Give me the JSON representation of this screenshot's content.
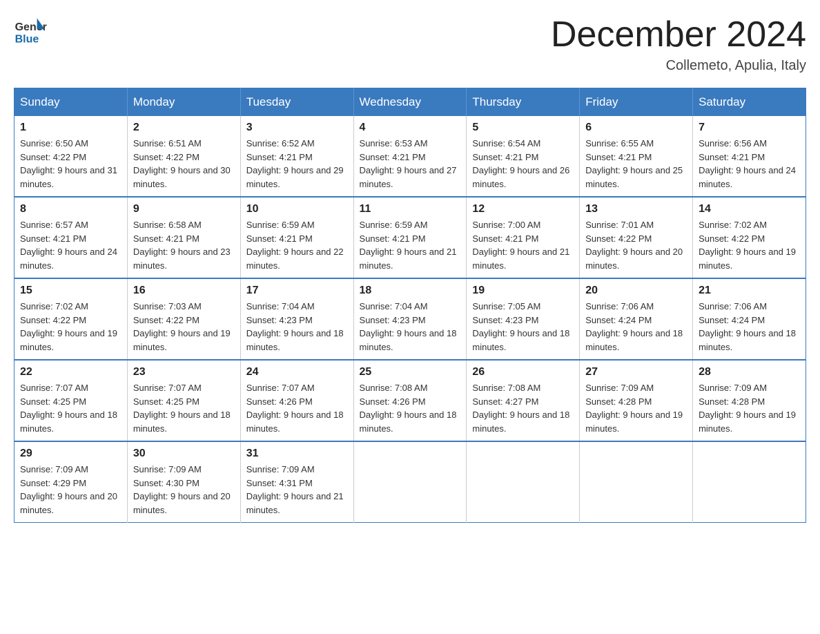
{
  "header": {
    "month_title": "December 2024",
    "location": "Collemeto, Apulia, Italy",
    "logo_general": "General",
    "logo_blue": "Blue"
  },
  "days_of_week": [
    "Sunday",
    "Monday",
    "Tuesday",
    "Wednesday",
    "Thursday",
    "Friday",
    "Saturday"
  ],
  "weeks": [
    [
      {
        "day": "1",
        "sunrise": "Sunrise: 6:50 AM",
        "sunset": "Sunset: 4:22 PM",
        "daylight": "Daylight: 9 hours and 31 minutes."
      },
      {
        "day": "2",
        "sunrise": "Sunrise: 6:51 AM",
        "sunset": "Sunset: 4:22 PM",
        "daylight": "Daylight: 9 hours and 30 minutes."
      },
      {
        "day": "3",
        "sunrise": "Sunrise: 6:52 AM",
        "sunset": "Sunset: 4:21 PM",
        "daylight": "Daylight: 9 hours and 29 minutes."
      },
      {
        "day": "4",
        "sunrise": "Sunrise: 6:53 AM",
        "sunset": "Sunset: 4:21 PM",
        "daylight": "Daylight: 9 hours and 27 minutes."
      },
      {
        "day": "5",
        "sunrise": "Sunrise: 6:54 AM",
        "sunset": "Sunset: 4:21 PM",
        "daylight": "Daylight: 9 hours and 26 minutes."
      },
      {
        "day": "6",
        "sunrise": "Sunrise: 6:55 AM",
        "sunset": "Sunset: 4:21 PM",
        "daylight": "Daylight: 9 hours and 25 minutes."
      },
      {
        "day": "7",
        "sunrise": "Sunrise: 6:56 AM",
        "sunset": "Sunset: 4:21 PM",
        "daylight": "Daylight: 9 hours and 24 minutes."
      }
    ],
    [
      {
        "day": "8",
        "sunrise": "Sunrise: 6:57 AM",
        "sunset": "Sunset: 4:21 PM",
        "daylight": "Daylight: 9 hours and 24 minutes."
      },
      {
        "day": "9",
        "sunrise": "Sunrise: 6:58 AM",
        "sunset": "Sunset: 4:21 PM",
        "daylight": "Daylight: 9 hours and 23 minutes."
      },
      {
        "day": "10",
        "sunrise": "Sunrise: 6:59 AM",
        "sunset": "Sunset: 4:21 PM",
        "daylight": "Daylight: 9 hours and 22 minutes."
      },
      {
        "day": "11",
        "sunrise": "Sunrise: 6:59 AM",
        "sunset": "Sunset: 4:21 PM",
        "daylight": "Daylight: 9 hours and 21 minutes."
      },
      {
        "day": "12",
        "sunrise": "Sunrise: 7:00 AM",
        "sunset": "Sunset: 4:21 PM",
        "daylight": "Daylight: 9 hours and 21 minutes."
      },
      {
        "day": "13",
        "sunrise": "Sunrise: 7:01 AM",
        "sunset": "Sunset: 4:22 PM",
        "daylight": "Daylight: 9 hours and 20 minutes."
      },
      {
        "day": "14",
        "sunrise": "Sunrise: 7:02 AM",
        "sunset": "Sunset: 4:22 PM",
        "daylight": "Daylight: 9 hours and 19 minutes."
      }
    ],
    [
      {
        "day": "15",
        "sunrise": "Sunrise: 7:02 AM",
        "sunset": "Sunset: 4:22 PM",
        "daylight": "Daylight: 9 hours and 19 minutes."
      },
      {
        "day": "16",
        "sunrise": "Sunrise: 7:03 AM",
        "sunset": "Sunset: 4:22 PM",
        "daylight": "Daylight: 9 hours and 19 minutes."
      },
      {
        "day": "17",
        "sunrise": "Sunrise: 7:04 AM",
        "sunset": "Sunset: 4:23 PM",
        "daylight": "Daylight: 9 hours and 18 minutes."
      },
      {
        "day": "18",
        "sunrise": "Sunrise: 7:04 AM",
        "sunset": "Sunset: 4:23 PM",
        "daylight": "Daylight: 9 hours and 18 minutes."
      },
      {
        "day": "19",
        "sunrise": "Sunrise: 7:05 AM",
        "sunset": "Sunset: 4:23 PM",
        "daylight": "Daylight: 9 hours and 18 minutes."
      },
      {
        "day": "20",
        "sunrise": "Sunrise: 7:06 AM",
        "sunset": "Sunset: 4:24 PM",
        "daylight": "Daylight: 9 hours and 18 minutes."
      },
      {
        "day": "21",
        "sunrise": "Sunrise: 7:06 AM",
        "sunset": "Sunset: 4:24 PM",
        "daylight": "Daylight: 9 hours and 18 minutes."
      }
    ],
    [
      {
        "day": "22",
        "sunrise": "Sunrise: 7:07 AM",
        "sunset": "Sunset: 4:25 PM",
        "daylight": "Daylight: 9 hours and 18 minutes."
      },
      {
        "day": "23",
        "sunrise": "Sunrise: 7:07 AM",
        "sunset": "Sunset: 4:25 PM",
        "daylight": "Daylight: 9 hours and 18 minutes."
      },
      {
        "day": "24",
        "sunrise": "Sunrise: 7:07 AM",
        "sunset": "Sunset: 4:26 PM",
        "daylight": "Daylight: 9 hours and 18 minutes."
      },
      {
        "day": "25",
        "sunrise": "Sunrise: 7:08 AM",
        "sunset": "Sunset: 4:26 PM",
        "daylight": "Daylight: 9 hours and 18 minutes."
      },
      {
        "day": "26",
        "sunrise": "Sunrise: 7:08 AM",
        "sunset": "Sunset: 4:27 PM",
        "daylight": "Daylight: 9 hours and 18 minutes."
      },
      {
        "day": "27",
        "sunrise": "Sunrise: 7:09 AM",
        "sunset": "Sunset: 4:28 PM",
        "daylight": "Daylight: 9 hours and 19 minutes."
      },
      {
        "day": "28",
        "sunrise": "Sunrise: 7:09 AM",
        "sunset": "Sunset: 4:28 PM",
        "daylight": "Daylight: 9 hours and 19 minutes."
      }
    ],
    [
      {
        "day": "29",
        "sunrise": "Sunrise: 7:09 AM",
        "sunset": "Sunset: 4:29 PM",
        "daylight": "Daylight: 9 hours and 20 minutes."
      },
      {
        "day": "30",
        "sunrise": "Sunrise: 7:09 AM",
        "sunset": "Sunset: 4:30 PM",
        "daylight": "Daylight: 9 hours and 20 minutes."
      },
      {
        "day": "31",
        "sunrise": "Sunrise: 7:09 AM",
        "sunset": "Sunset: 4:31 PM",
        "daylight": "Daylight: 9 hours and 21 minutes."
      },
      {
        "day": "",
        "sunrise": "",
        "sunset": "",
        "daylight": ""
      },
      {
        "day": "",
        "sunrise": "",
        "sunset": "",
        "daylight": ""
      },
      {
        "day": "",
        "sunrise": "",
        "sunset": "",
        "daylight": ""
      },
      {
        "day": "",
        "sunrise": "",
        "sunset": "",
        "daylight": ""
      }
    ]
  ]
}
